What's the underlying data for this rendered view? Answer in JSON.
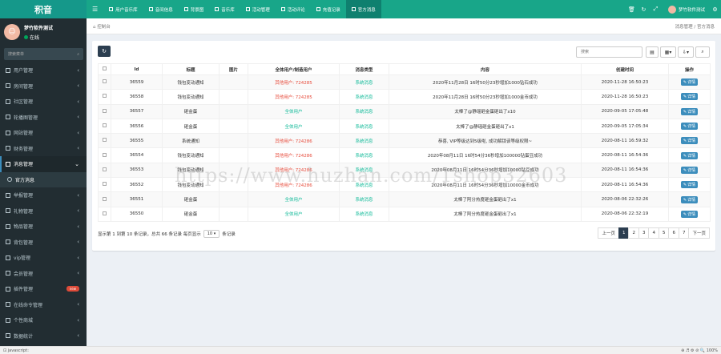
{
  "app": {
    "logo": "积音"
  },
  "user": {
    "avatar_glyph": "☺",
    "name": "梦竹软件测试",
    "status": "在线"
  },
  "sidebar": {
    "search_placeholder": "搜索菜单",
    "items": [
      {
        "label": "用户管理",
        "icon": "user-icon",
        "state": "normal"
      },
      {
        "label": "房间管理",
        "icon": "home-icon",
        "state": "normal"
      },
      {
        "label": "社区管理",
        "icon": "community-icon",
        "state": "normal"
      },
      {
        "label": "轮播图管理",
        "icon": "image-icon",
        "state": "normal"
      },
      {
        "label": "网站管理",
        "icon": "globe-icon",
        "state": "normal"
      },
      {
        "label": "财务管理",
        "icon": "finance-icon",
        "state": "normal"
      },
      {
        "label": "消息管理",
        "icon": "message-icon",
        "state": "active"
      },
      {
        "label": "官方消息",
        "icon": "circle-icon",
        "state": "sub"
      },
      {
        "label": "举报管理",
        "icon": "report-icon",
        "state": "normal"
      },
      {
        "label": "礼物管理",
        "icon": "gift-icon",
        "state": "normal"
      },
      {
        "label": "物品管理",
        "icon": "box-icon",
        "state": "normal"
      },
      {
        "label": "背包管理",
        "icon": "bag-icon",
        "state": "normal"
      },
      {
        "label": "vip管理",
        "icon": "vip-icon",
        "state": "normal"
      },
      {
        "label": "会员管理",
        "icon": "member-icon",
        "state": "normal"
      },
      {
        "label": "插件管理",
        "icon": "plugin-icon",
        "state": "normal",
        "badge": "new"
      },
      {
        "label": "在线命令管理",
        "icon": "command-icon",
        "state": "normal"
      },
      {
        "label": "个性商城",
        "icon": "shop-icon",
        "state": "normal"
      },
      {
        "label": "数据统计",
        "icon": "stats-icon",
        "state": "normal"
      }
    ]
  },
  "topbar": {
    "menu_glyph": "☰",
    "tabs": [
      {
        "label": "用户音乐库",
        "active": false
      },
      {
        "label": "音间信息",
        "active": false
      },
      {
        "label": "背景图",
        "active": false
      },
      {
        "label": "音乐库",
        "active": false
      },
      {
        "label": "活动管理",
        "active": false
      },
      {
        "label": "活动评论",
        "active": false
      },
      {
        "label": "充值记录",
        "active": false
      },
      {
        "label": "官方消息",
        "active": true
      }
    ],
    "right_icons": [
      "trash-icon",
      "refresh-icon",
      "fullscreen-icon"
    ],
    "user_name": "梦竹软件测试",
    "settings_glyph": "⚙"
  },
  "breadcrumb": {
    "home": "控制台",
    "path": [
      "消息管理",
      "官方消息"
    ]
  },
  "toolbar": {
    "refresh_glyph": "↻",
    "search_placeholder": "搜索"
  },
  "table": {
    "headers": [
      "Id",
      "标题",
      "图片",
      "全体用户/制造用户",
      "消息类型",
      "内容",
      "创建时间",
      "操作"
    ],
    "detail_label": "详情",
    "rows": [
      {
        "id": "36559",
        "title": "钱包变动通知",
        "users": "其他用户: 724285",
        "users_type": "red",
        "type": "系统消息",
        "content": "2020年11月28日 16时50分23秒增加1000钻石成功",
        "time": "2020-11-28 16:50:23"
      },
      {
        "id": "36558",
        "title": "钱包变动通知",
        "users": "其他用户: 724285",
        "users_type": "red",
        "type": "系统消息",
        "content": "2020年11月28日 16时50分23秒增加1000金币成功",
        "time": "2020-11-28 16:50:23"
      },
      {
        "id": "36557",
        "title": "砸金蛋",
        "users": "全体用户",
        "users_type": "green",
        "type": "系统消息",
        "content": "太棒了@静瑶砸金蛋砸出了x10",
        "time": "2020-09-05 17:05:48"
      },
      {
        "id": "36556",
        "title": "砸金蛋",
        "users": "全体用户",
        "users_type": "green",
        "type": "系统消息",
        "content": "太棒了@静瑶砸金蛋砸出了x1",
        "time": "2020-09-05 17:05:34"
      },
      {
        "id": "36555",
        "title": "系统通知",
        "users": "其他用户: 724286",
        "users_type": "red",
        "type": "系统消息",
        "content": "恭喜, VIP等级达到5级啦, 成功解锁该等级权限~",
        "time": "2020-08-11 16:59:32"
      },
      {
        "id": "36554",
        "title": "钱包变动通知",
        "users": "其他用户: 724286",
        "users_type": "red",
        "type": "系统消息",
        "content": "2020年08月11日 16时54分36秒增加100000钻蛋豆成功",
        "time": "2020-08-11 16:54:36"
      },
      {
        "id": "36553",
        "title": "钱包变动通知",
        "users": "其他用户: 724286",
        "users_type": "red",
        "type": "系统消息",
        "content": "2020年08月11日 16时54分36秒增加10000钻豆成功",
        "time": "2020-08-11 16:54:36"
      },
      {
        "id": "36552",
        "title": "钱包变动通知",
        "users": "其他用户: 724286",
        "users_type": "red",
        "type": "系统消息",
        "content": "2020年08月11日 16时54分36秒增加10000金币成功",
        "time": "2020-08-11 16:54:36"
      },
      {
        "id": "36551",
        "title": "砸金蛋",
        "users": "全体用户",
        "users_type": "green",
        "type": "系统消息",
        "content": "太棒了阿分热度砸金蛋砸出了x1",
        "time": "2020-08-06 22:32:26"
      },
      {
        "id": "36550",
        "title": "砸金蛋",
        "users": "全体用户",
        "users_type": "green",
        "type": "系统消息",
        "content": "太棒了阿分热度砸金蛋砸出了x1",
        "time": "2020-08-06 22:32:19"
      }
    ]
  },
  "pagination": {
    "info_before": "显示第 1 到第 10 条记录，总共 66 条记录 每页显示",
    "page_size": "10",
    "info_after": "条记录",
    "prev": "上一页",
    "pages": [
      "1",
      "2",
      "3",
      "4",
      "5",
      "6",
      "7"
    ],
    "current": "1",
    "next": "下一页"
  },
  "statusbar": {
    "left": "javascript:",
    "zoom": "100%"
  },
  "watermark": "https://www.huzhan.com/1shop32603",
  "colors": {
    "sidebar_bg": "#222d32",
    "topbar_bg": "#18a689",
    "red_text": "#e74c3c",
    "green_text": "#18bc9c",
    "detail_button": "#3c8dbc"
  }
}
